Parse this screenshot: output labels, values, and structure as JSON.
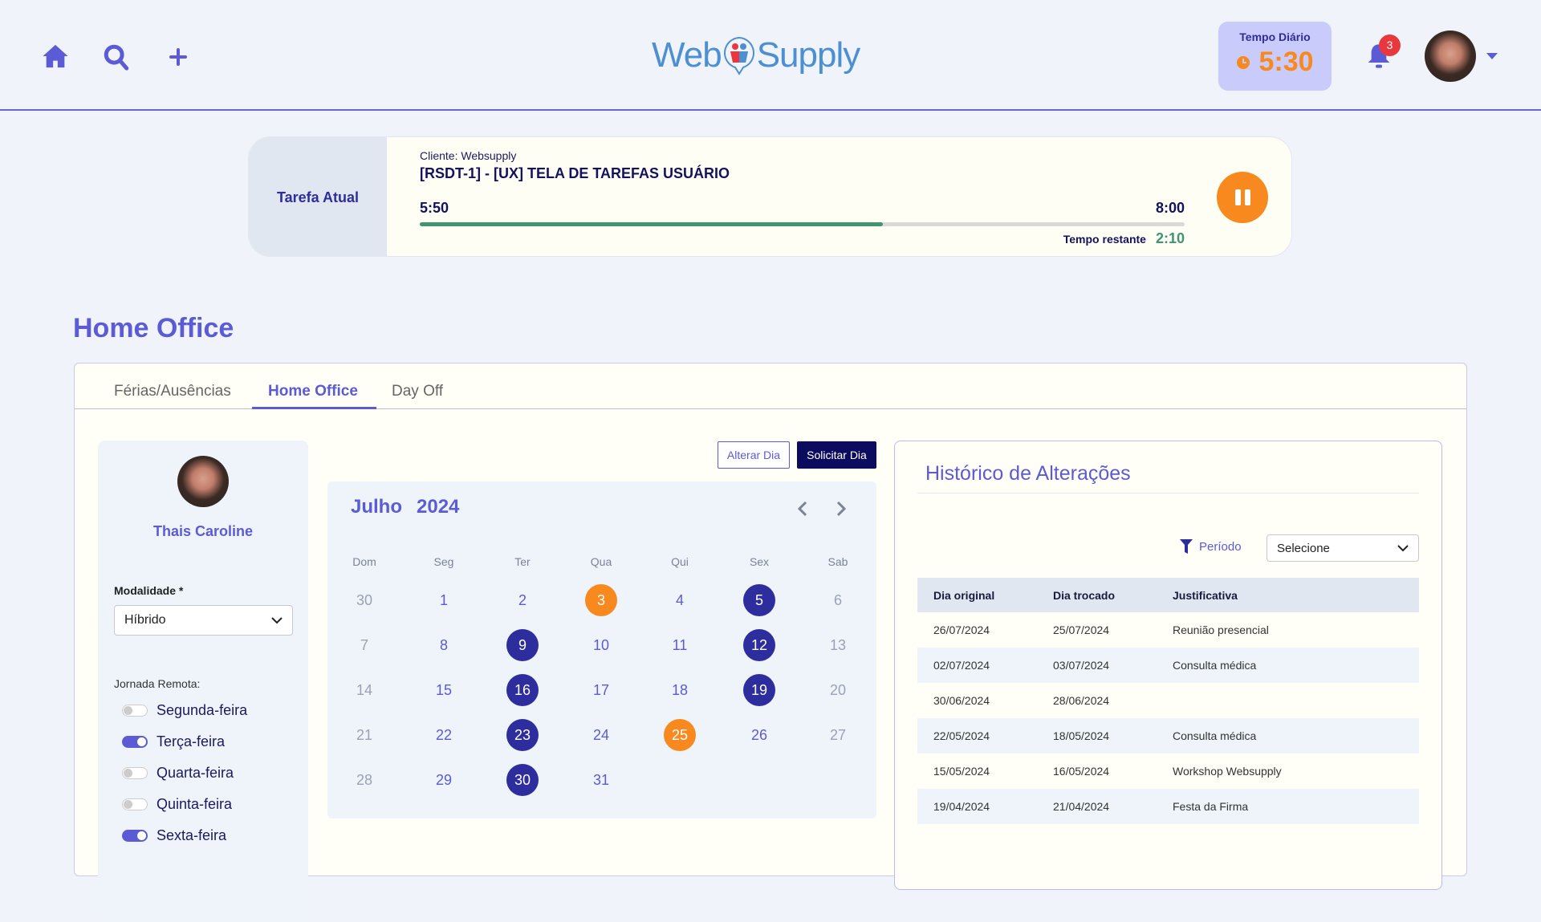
{
  "header": {
    "logo_left": "Web",
    "logo_right": "Supply",
    "tempo_label": "Tempo Diário",
    "tempo_value": "5:30",
    "notifications": "3"
  },
  "task": {
    "side_label": "Tarefa Atual",
    "client": "Cliente: Websupply",
    "title": "[RSDT-1] - [UX] TELA DE TAREFAS USUÁRIO",
    "elapsed": "5:50",
    "total": "8:00",
    "progress": 0.605,
    "remaining_label": "Tempo restante",
    "remaining": "2:10"
  },
  "page_title": "Home Office",
  "tabs": [
    "Férias/Ausências",
    "Home Office",
    "Day Off"
  ],
  "profile": {
    "name": "Thais Caroline",
    "modalidade_label": "Modalidade *",
    "modalidade_value": "Híbrido",
    "jornada_label": "Jornada Remota:",
    "days": [
      {
        "label": "Segunda-feira",
        "on": false
      },
      {
        "label": "Terça-feira",
        "on": true
      },
      {
        "label": "Quarta-feira",
        "on": false
      },
      {
        "label": "Quinta-feira",
        "on": false
      },
      {
        "label": "Sexta-feira",
        "on": true
      }
    ]
  },
  "actions": {
    "alterar": "Alterar Dia",
    "solicitar": "Solicitar Dia"
  },
  "calendar": {
    "month": "Julho",
    "year": "2024",
    "weekdays": [
      "Dom",
      "Seg",
      "Ter",
      "Qua",
      "Qui",
      "Sex",
      "Sab"
    ],
    "weeks": [
      [
        [
          "30",
          "muted"
        ],
        [
          "1",
          ""
        ],
        [
          "2",
          ""
        ],
        [
          "3",
          "swap"
        ],
        [
          "4",
          ""
        ],
        [
          "5",
          "office"
        ],
        [
          "6",
          "muted"
        ]
      ],
      [
        [
          "7",
          "muted"
        ],
        [
          "8",
          ""
        ],
        [
          "9",
          "office"
        ],
        [
          "10",
          ""
        ],
        [
          "11",
          ""
        ],
        [
          "12",
          "office"
        ],
        [
          "13",
          "muted"
        ]
      ],
      [
        [
          "14",
          "muted"
        ],
        [
          "15",
          ""
        ],
        [
          "16",
          "office"
        ],
        [
          "17",
          ""
        ],
        [
          "18",
          ""
        ],
        [
          "19",
          "office"
        ],
        [
          "20",
          "muted"
        ]
      ],
      [
        [
          "21",
          "muted"
        ],
        [
          "22",
          ""
        ],
        [
          "23",
          "office"
        ],
        [
          "24",
          ""
        ],
        [
          "25",
          "swap"
        ],
        [
          "26",
          ""
        ],
        [
          "27",
          "muted"
        ]
      ],
      [
        [
          "28",
          "muted"
        ],
        [
          "29",
          ""
        ],
        [
          "30",
          "office"
        ],
        [
          "31",
          ""
        ]
      ]
    ]
  },
  "history": {
    "title": "Histórico de Alterações",
    "filter_label": "Período",
    "filter_value": "Selecione",
    "columns": [
      "Dia original",
      "Dia trocado",
      "Justificativa"
    ],
    "rows": [
      [
        "26/07/2024",
        "25/07/2024",
        "Reunião presencial"
      ],
      [
        "02/07/2024",
        "03/07/2024",
        "Consulta médica"
      ],
      [
        "30/06/2024",
        "28/06/2024",
        ""
      ],
      [
        "22/05/2024",
        "18/05/2024",
        "Consulta médica"
      ],
      [
        "15/05/2024",
        "16/05/2024",
        "Workshop Websupply"
      ],
      [
        "19/04/2024",
        "21/04/2024",
        "Festa da Firma"
      ]
    ]
  },
  "colors": {
    "accent": "#5b5bd6",
    "navy": "#2d2d9e",
    "orange": "#f7891f",
    "green": "#3f9471"
  }
}
